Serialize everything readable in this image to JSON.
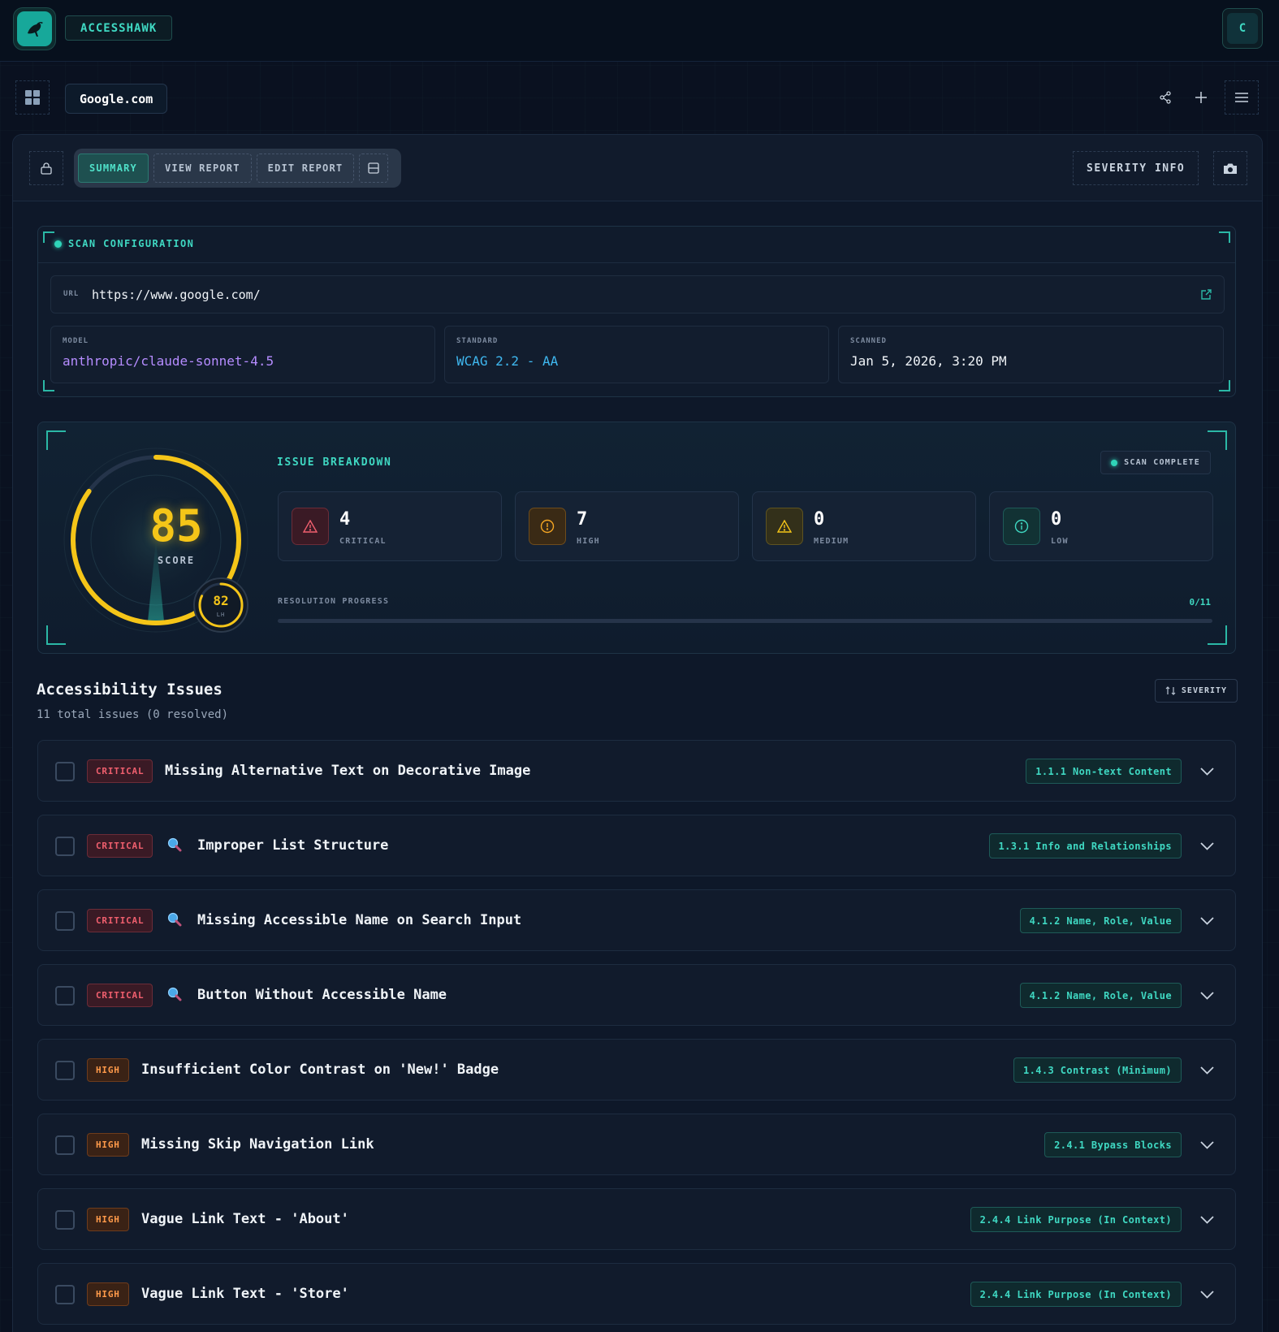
{
  "topbar": {
    "brand": "ACCESSHAWK",
    "avatar_initial": "C"
  },
  "site": {
    "name": "Google.com"
  },
  "tabs": {
    "summary": "SUMMARY",
    "view_report": "VIEW REPORT",
    "edit_report": "EDIT REPORT",
    "severity_info": "SEVERITY INFO"
  },
  "scan_config": {
    "title": "SCAN CONFIGURATION",
    "url_label": "URL",
    "url": "https://www.google.com/",
    "model_label": "MODEL",
    "model": "anthropic/claude-sonnet-4.5",
    "standard_label": "STANDARD",
    "standard": "WCAG 2.2 - AA",
    "scanned_label": "SCANNED",
    "scanned": "Jan 5, 2026, 3:20 PM"
  },
  "score": {
    "value": "85",
    "label": "SCORE",
    "fraction": 0.85,
    "lh_value": "82",
    "lh_label": "LH",
    "lh_fraction": 0.82
  },
  "breakdown": {
    "title": "ISSUE BREAKDOWN",
    "status": "SCAN COMPLETE",
    "stats": [
      {
        "count": "4",
        "label": "CRITICAL"
      },
      {
        "count": "7",
        "label": "HIGH"
      },
      {
        "count": "0",
        "label": "MEDIUM"
      },
      {
        "count": "0",
        "label": "LOW"
      }
    ],
    "progress_label": "RESOLUTION PROGRESS",
    "progress_value": "0/11",
    "progress_fraction": 0
  },
  "issues_section": {
    "title": "Accessibility Issues",
    "subtitle": "11 total issues (0 resolved)",
    "sort_label": "SEVERITY"
  },
  "issues": [
    {
      "severity": "CRITICAL",
      "title": "Missing Alternative Text on Decorative Image",
      "wcag": "1.1.1 Non-text Content",
      "magnifier": false
    },
    {
      "severity": "CRITICAL",
      "title": "Improper List Structure",
      "wcag": "1.3.1 Info and Relationships",
      "magnifier": true
    },
    {
      "severity": "CRITICAL",
      "title": "Missing Accessible Name on Search Input",
      "wcag": "4.1.2 Name, Role, Value",
      "magnifier": true
    },
    {
      "severity": "CRITICAL",
      "title": "Button Without Accessible Name",
      "wcag": "4.1.2 Name, Role, Value",
      "magnifier": true
    },
    {
      "severity": "HIGH",
      "title": "Insufficient Color Contrast on 'New!' Badge",
      "wcag": "1.4.3 Contrast (Minimum)",
      "magnifier": false
    },
    {
      "severity": "HIGH",
      "title": "Missing Skip Navigation Link",
      "wcag": "2.4.1 Bypass Blocks",
      "magnifier": false
    },
    {
      "severity": "HIGH",
      "title": "Vague Link Text - 'About'",
      "wcag": "2.4.4 Link Purpose (In Context)",
      "magnifier": false
    },
    {
      "severity": "HIGH",
      "title": "Vague Link Text - 'Store'",
      "wcag": "2.4.4 Link Purpose (In Context)",
      "magnifier": false
    }
  ],
  "colors": {
    "accent": "#3fd8c2",
    "score_ring": "#f5c518",
    "critical": "#f05f6e",
    "high": "#ff9a4a",
    "medium": "#f5c518",
    "low": "#3fd8c2",
    "model_text": "#b58cff",
    "standard_text": "#3fb8f0"
  }
}
